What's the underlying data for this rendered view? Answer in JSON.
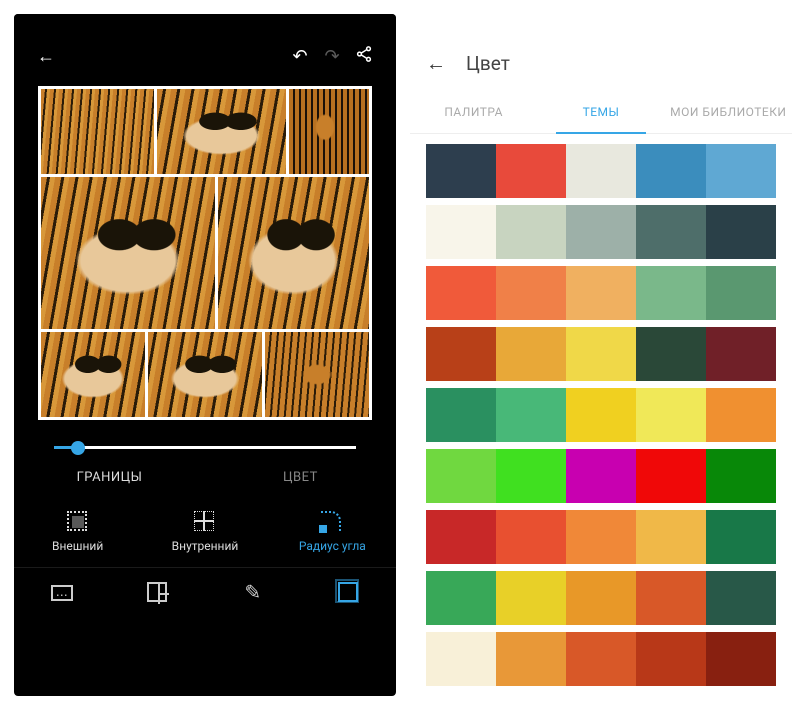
{
  "left": {
    "tabs": {
      "borders": "ГРАНИЦЫ",
      "color": "ЦВЕТ"
    },
    "options": {
      "outer": "Внешний",
      "inner": "Внутренний",
      "radius": "Радиус угла"
    },
    "slider_value": 8,
    "accent": "#36a6e6"
  },
  "right": {
    "title": "Цвет",
    "tabs": {
      "palette": "ПАЛИТРА",
      "themes": "ТЕМЫ",
      "libraries": "МОИ БИБЛИОТЕКИ"
    },
    "themes": [
      [
        "#2d3e4e",
        "#e84a3b",
        "#e8e8de",
        "#3b8dbd",
        "#5fa8d3"
      ],
      [
        "#f8f5ea",
        "#c8d4c0",
        "#9db0a8",
        "#4e6e6a",
        "#2a4048"
      ],
      [
        "#f05a3a",
        "#f08048",
        "#f0b060",
        "#7ab88a",
        "#5a9870"
      ],
      [
        "#b84018",
        "#e8a838",
        "#f0d848",
        "#2a4838",
        "#702028"
      ],
      [
        "#2a9060",
        "#48b878",
        "#f0d020",
        "#f0e858",
        "#f09030"
      ],
      [
        "#70d840",
        "#40e020",
        "#c800b0",
        "#f00808",
        "#088808"
      ],
      [
        "#c82828",
        "#e85030",
        "#f08838",
        "#f0b848",
        "#187848"
      ],
      [
        "#38a858",
        "#e8d028",
        "#e89828",
        "#d85828",
        "#285848"
      ],
      [
        "#f8f0d8",
        "#e89838",
        "#d85828",
        "#b83818",
        "#882010"
      ]
    ]
  }
}
